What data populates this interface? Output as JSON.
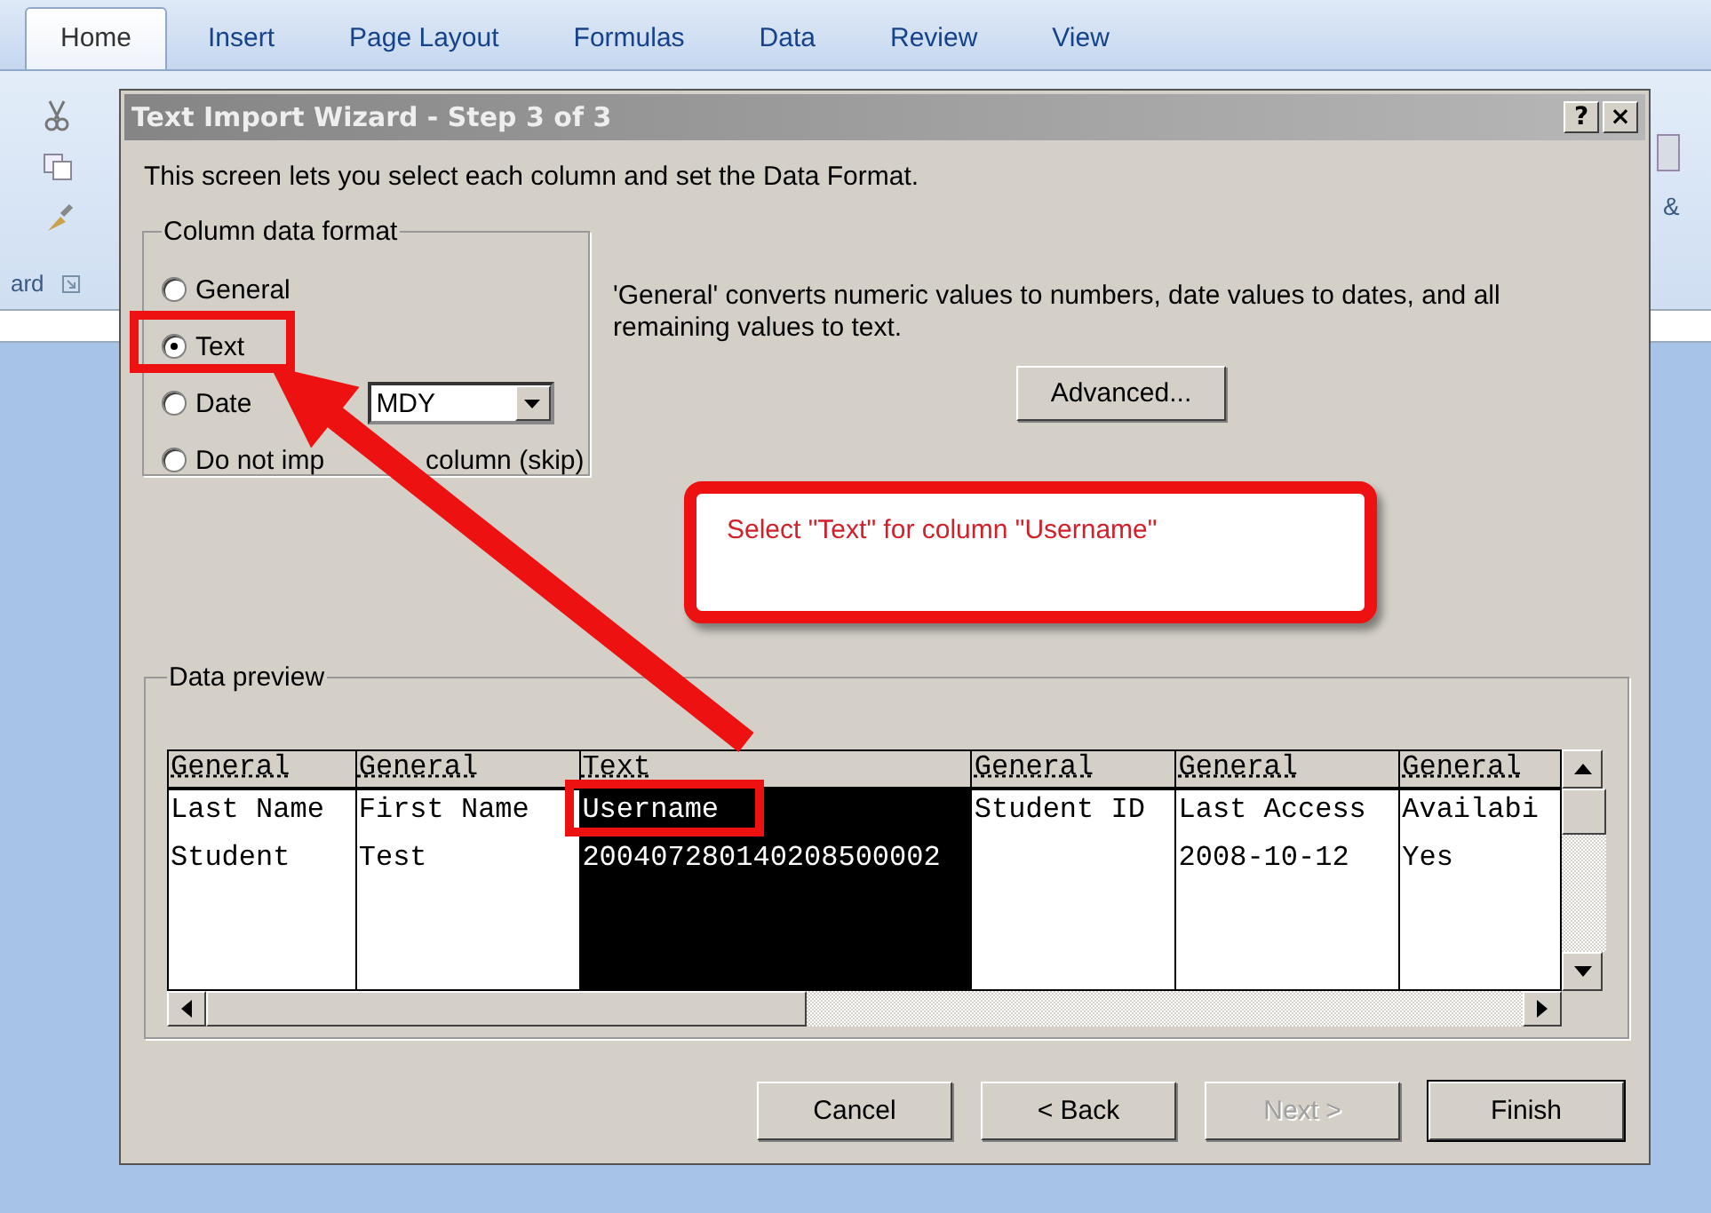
{
  "ribbon": {
    "tabs": [
      {
        "label": "Home",
        "selected": true
      },
      {
        "label": "Insert",
        "selected": false
      },
      {
        "label": "Page Layout",
        "selected": false
      },
      {
        "label": "Formulas",
        "selected": false
      },
      {
        "label": "Data",
        "selected": false
      },
      {
        "label": "Review",
        "selected": false
      },
      {
        "label": "View",
        "selected": false
      }
    ],
    "group_label_left": "ard",
    "group_label_right": "&"
  },
  "dialog": {
    "title": "Text Import Wizard - Step 3 of 3",
    "help_button": "?",
    "close_button": "×",
    "description": "This screen lets you select each column and set the Data Format.",
    "format_group": {
      "title": "Column data format",
      "options": [
        {
          "label": "General",
          "selected": false
        },
        {
          "label": "Text",
          "selected": true
        },
        {
          "label": "Date",
          "selected": false,
          "dropdown": "MDY"
        },
        {
          "label": "Do not imp",
          "label_after": "column (skip)",
          "selected": false
        }
      ]
    },
    "note": "'General' converts numeric values to numbers, date values to dates, and all remaining values to text.",
    "advanced_button": "Advanced...",
    "preview": {
      "title": "Data preview",
      "columns": [
        {
          "format": "General",
          "selected": false,
          "cells": [
            "Last Name",
            "Student"
          ]
        },
        {
          "format": "General",
          "selected": false,
          "cells": [
            "First Name",
            "Test"
          ]
        },
        {
          "format": "Text",
          "selected": true,
          "cells": [
            "Username",
            "200407280140208500002"
          ]
        },
        {
          "format": "General",
          "selected": false,
          "cells": [
            "Student ID"
          ]
        },
        {
          "format": "General",
          "selected": false,
          "cells": [
            "Last Access",
            "2008-10-12"
          ]
        },
        {
          "format": "General",
          "selected": false,
          "cells": [
            "Availabi",
            "Yes"
          ]
        }
      ]
    },
    "buttons": [
      {
        "label": "Cancel",
        "disabled": false,
        "default": false
      },
      {
        "label": "< Back",
        "disabled": false,
        "default": false
      },
      {
        "label": "Next >",
        "disabled": true,
        "default": false
      },
      {
        "label": "Finish",
        "disabled": false,
        "default": true
      }
    ]
  },
  "annotation": {
    "callout": "Select \"Text\" for column \"Username\""
  }
}
